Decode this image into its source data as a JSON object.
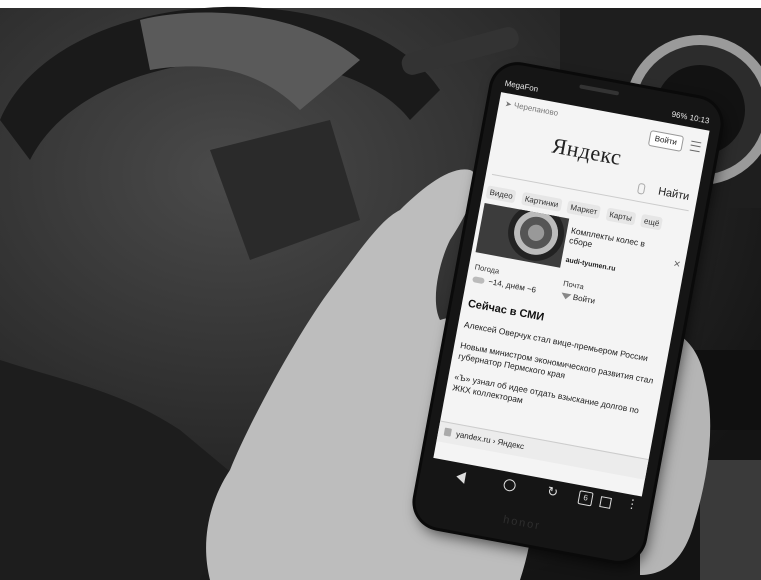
{
  "status_bar": {
    "carrier": "MegaFon",
    "battery": "96%",
    "time": "10:13"
  },
  "header": {
    "location": "Черепаново",
    "login": "Войти"
  },
  "logo": "Яндекс",
  "search": {
    "placeholder": "",
    "button": "Найти"
  },
  "tabs": [
    "Видео",
    "Картинки",
    "Маркет",
    "Карты",
    "ещё"
  ],
  "ad": {
    "title": "Комплекты колес в сборе",
    "domain": "audi-tyumen.ru"
  },
  "weather": {
    "label": "Погода",
    "value": "−14, днём −6"
  },
  "mail": {
    "label": "Почта",
    "button": "Войти"
  },
  "news": {
    "heading": "Сейчас в СМИ",
    "items": [
      "Алексей Оверчук стал вице-премьером России",
      "Новым министром экономического развития стал губернатор Пермского края",
      "«Ъ» узнал об идее отдать взыскание долгов по ЖКХ коллекторам"
    ]
  },
  "url_bar": {
    "text": "yandex.ru › Яндекс"
  },
  "nav": {
    "tab_count": "6"
  },
  "brand": "honor"
}
